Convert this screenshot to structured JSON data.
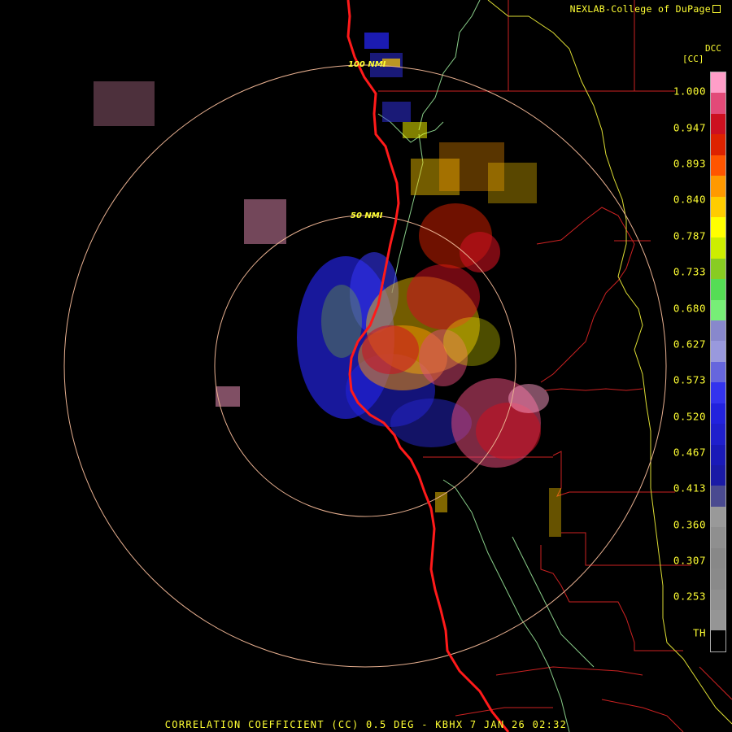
{
  "credit": "NEXLAB-College of DuPage",
  "product": {
    "code": "DCC",
    "label": "[CC]"
  },
  "range_rings": [
    "50 NMI",
    "100 NMI"
  ],
  "colorbar": {
    "ticks": [
      "1.000",
      "0.947",
      "0.893",
      "0.840",
      "0.787",
      "0.733",
      "0.680",
      "0.627",
      "0.573",
      "0.520",
      "0.467",
      "0.413",
      "0.360",
      "0.307",
      "0.253",
      "TH"
    ],
    "colors": [
      "#ff9ec8",
      "#e24a78",
      "#cc1020",
      "#dd2200",
      "#ff5500",
      "#ff9900",
      "#ffcc00",
      "#ffff00",
      "#ccee00",
      "#88cc22",
      "#55dd55",
      "#77ee77",
      "#8888cc",
      "#9999dd",
      "#6666dd",
      "#3333ee",
      "#2222dd",
      "#1f1fcc",
      "#1a1ab8",
      "#1a1aa6",
      "#4a4a90",
      "#999999",
      "#8f8f8f",
      "#888888",
      "#8a8a8a",
      "#909090",
      "#959595",
      "#000000"
    ]
  },
  "footer": "CORRELATION COEFFICIENT (CC) 0.5 DEG - KBHX 7 JAN 26 02:32"
}
